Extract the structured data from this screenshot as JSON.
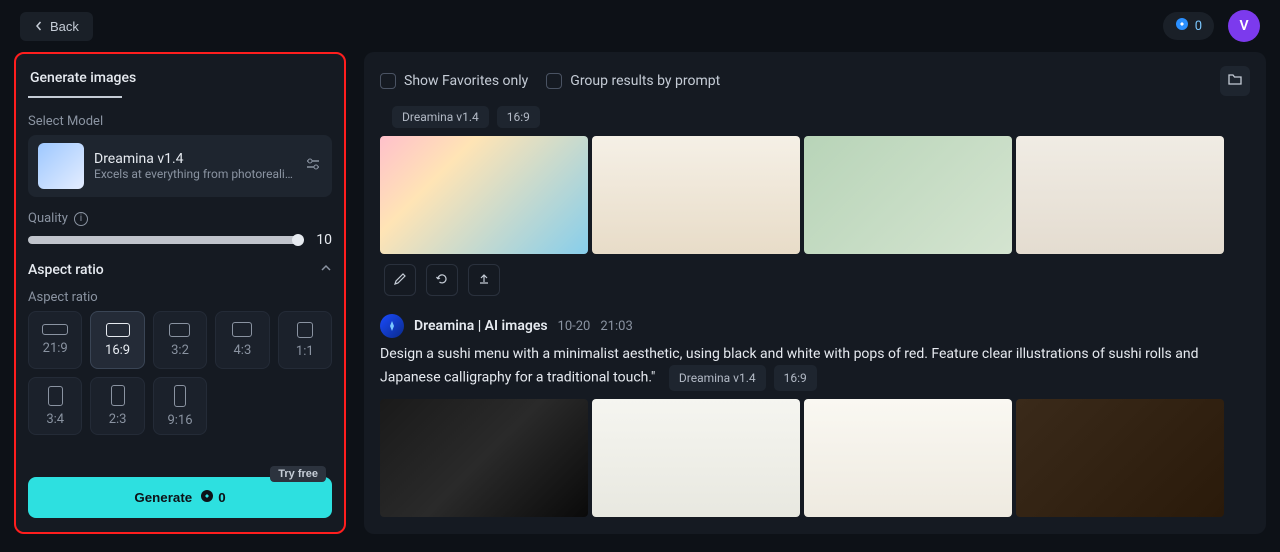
{
  "topbar": {
    "back_label": "Back",
    "credits": "0",
    "avatar_initial": "V"
  },
  "sidebar": {
    "tab_label": "Generate images",
    "select_model_label": "Select Model",
    "model": {
      "name": "Dreamina v1.4",
      "desc": "Excels at everything from photoreali..."
    },
    "quality_label": "Quality",
    "quality_value": "10",
    "aspect_section_label": "Aspect ratio",
    "aspect_sub_label": "Aspect ratio",
    "ratios": [
      "21:9",
      "16:9",
      "3:2",
      "4:3",
      "1:1",
      "3:4",
      "2:3",
      "9:16"
    ],
    "selected_ratio": "16:9",
    "generate_label": "Generate",
    "generate_cost": "0",
    "try_free_label": "Try free"
  },
  "main": {
    "show_favorites_label": "Show Favorites only",
    "group_results_label": "Group results by prompt",
    "result1_tags": [
      "Dreamina v1.4",
      "16:9"
    ],
    "gen2": {
      "title": "Dreamina | AI images",
      "date": "10-20",
      "time": "21:03",
      "prompt": "Design a sushi menu with a minimalist aesthetic, using black and white with pops of red. Feature clear illustrations of sushi rolls and Japanese calligraphy for a traditional touch.\"",
      "tags": [
        "Dreamina v1.4",
        "16:9"
      ]
    }
  }
}
